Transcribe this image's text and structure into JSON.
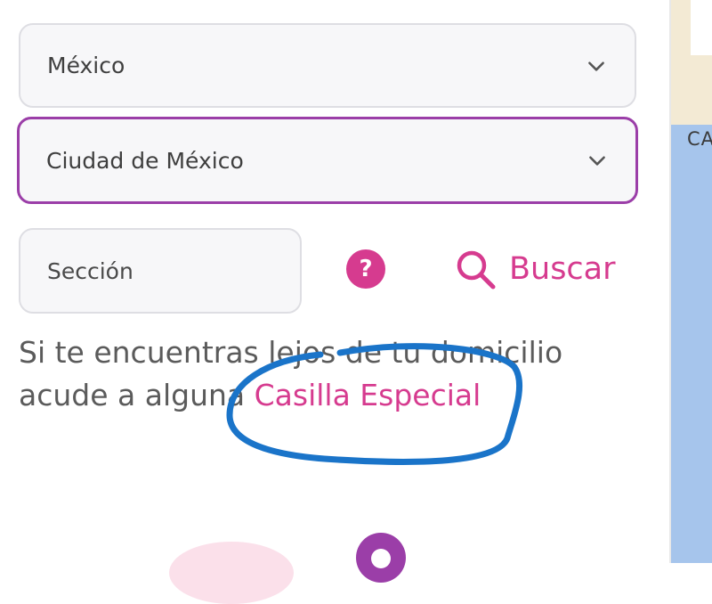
{
  "form": {
    "country_select": {
      "value": "México"
    },
    "state_select": {
      "value": "Ciudad de México"
    },
    "section_input": {
      "placeholder": "Sección"
    },
    "help_symbol": "?",
    "search_button": {
      "label": "Buscar"
    }
  },
  "note": {
    "line1": "Si te encuentras lejos de tu domicilio",
    "line2_prefix": "acude a alguna ",
    "link_text": "Casilla Especial"
  },
  "map": {
    "label": "CA"
  },
  "colors": {
    "accent_pink": "#d63b8f",
    "focus_purple": "#9b3ea8",
    "annotation_blue": "#1a74c9"
  },
  "icons": [
    "chevron-down-icon",
    "question-icon",
    "search-icon"
  ]
}
